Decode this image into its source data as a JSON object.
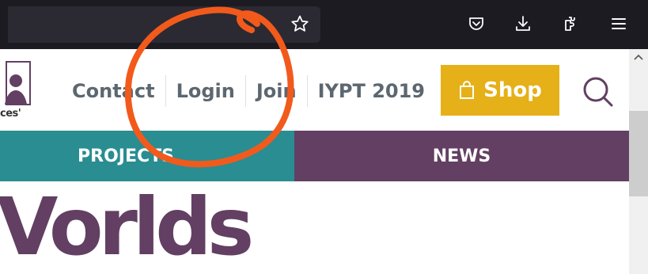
{
  "browser": {
    "icons": [
      "star-icon",
      "pocket-icon",
      "download-icon",
      "extensions-icon",
      "menu-icon"
    ]
  },
  "header": {
    "nav": [
      {
        "label": "Contact"
      },
      {
        "label": "Login"
      },
      {
        "label": "Join"
      },
      {
        "label": "IYPT 2019"
      }
    ],
    "logo_caption": "ces'",
    "shop_label": "Shop"
  },
  "main_nav": {
    "projects": "PROJECTS",
    "news": "NEWS"
  },
  "hero": {
    "title": "Vorlds"
  },
  "colors": {
    "teal": "#2a8d91",
    "purple": "#623f63",
    "shop_yellow": "#e5b018",
    "annotation": "#f25a1c"
  }
}
